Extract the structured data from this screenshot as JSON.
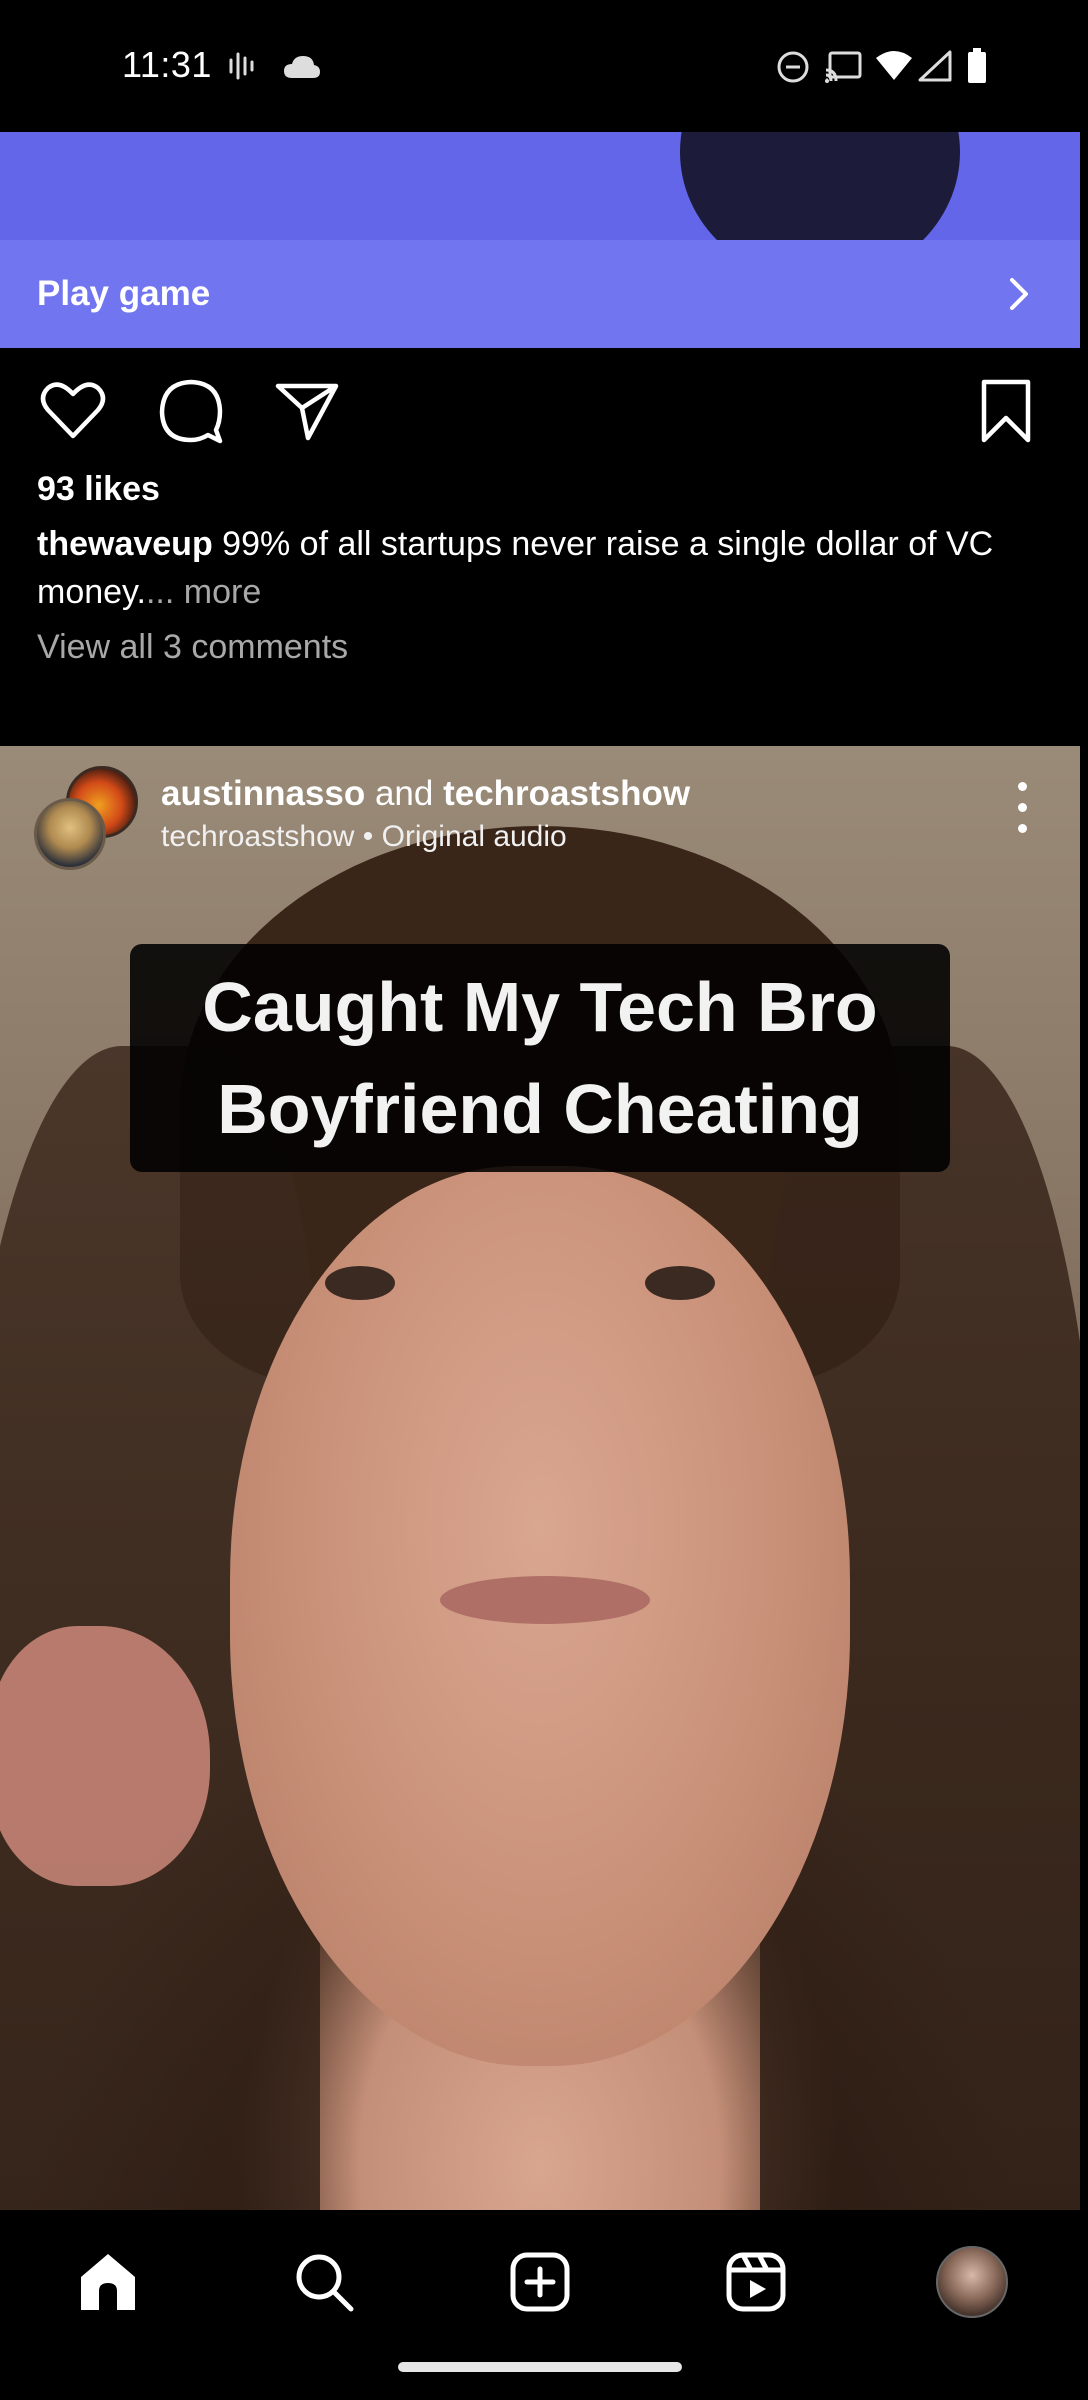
{
  "status_bar": {
    "time": "11:31",
    "icons": [
      "voicemail-icon",
      "cloud-icon",
      "do-not-disturb-icon",
      "cast-icon",
      "wifi-icon",
      "cellular-signal-icon",
      "battery-icon"
    ]
  },
  "game_post": {
    "play_label": "Play game",
    "likes": "93 likes",
    "caption_user": "thewaveup",
    "caption_text": " 99% of all startups never raise a single dollar of VC money.",
    "caption_more": "... more",
    "view_comments": "View all 3 comments"
  },
  "video_post": {
    "user1": "austinnasso",
    "joiner": " and ",
    "user2": "techroastshow",
    "audio": "techroastshow • Original audio",
    "overlay_line1": "Caught My Tech Bro",
    "overlay_line2": "Boyfriend Cheating"
  },
  "bottom_nav": {
    "items": [
      "home-icon",
      "search-icon",
      "create-icon",
      "reels-icon",
      "profile-avatar"
    ]
  },
  "colors": {
    "game_banner": "#6366e9",
    "play_bar": "#7275f0",
    "muted_text": "#a8a8a8"
  }
}
